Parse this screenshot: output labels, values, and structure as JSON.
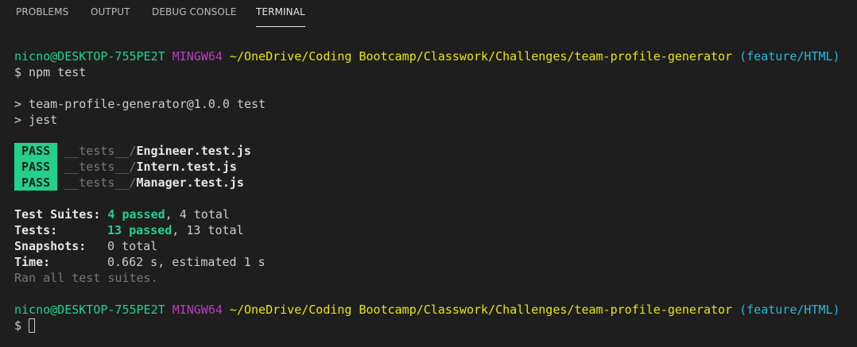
{
  "tabs": [
    {
      "label": "PROBLEMS",
      "active": false
    },
    {
      "label": "OUTPUT",
      "active": false
    },
    {
      "label": "DEBUG CONSOLE",
      "active": false
    },
    {
      "label": "TERMINAL",
      "active": true
    }
  ],
  "prompt": {
    "user_host": "nicno@DESKTOP-755PE2T",
    "env": "MINGW64",
    "path": "~/OneDrive/Coding Bootcamp/Classwork/Challenges/team-profile-generator",
    "branch": "(feature/HTML)"
  },
  "command": "$ npm test",
  "script_lines": [
    "> team-profile-generator@1.0.0 test",
    "> jest"
  ],
  "test_files": [
    {
      "status": "PASS",
      "dir": "__tests__/",
      "file": "Engineer.test.js"
    },
    {
      "status": "PASS",
      "dir": "__tests__/",
      "file": "Intern.test.js"
    },
    {
      "status": "PASS",
      "dir": "__tests__/",
      "file": "Manager.test.js"
    }
  ],
  "summary": {
    "suites_label": "Test Suites:",
    "suites_passed": "4 passed",
    "suites_total": ", 4 total",
    "tests_label": "Tests:",
    "tests_passed": "13 passed",
    "tests_total": ", 13 total",
    "snapshots_label": "Snapshots:",
    "snapshots_value": "0 total",
    "time_label": "Time:",
    "time_value": "0.662 s, estimated 1 s",
    "ran_all": "Ran all test suites."
  },
  "final_prompt": "$ ",
  "colors": {
    "background": "#1e1e1e",
    "pass_badge": "#23d18b",
    "user_host": "#23d18b",
    "env": "#bc3fbc",
    "path": "#e5e510",
    "branch": "#29b8db"
  }
}
